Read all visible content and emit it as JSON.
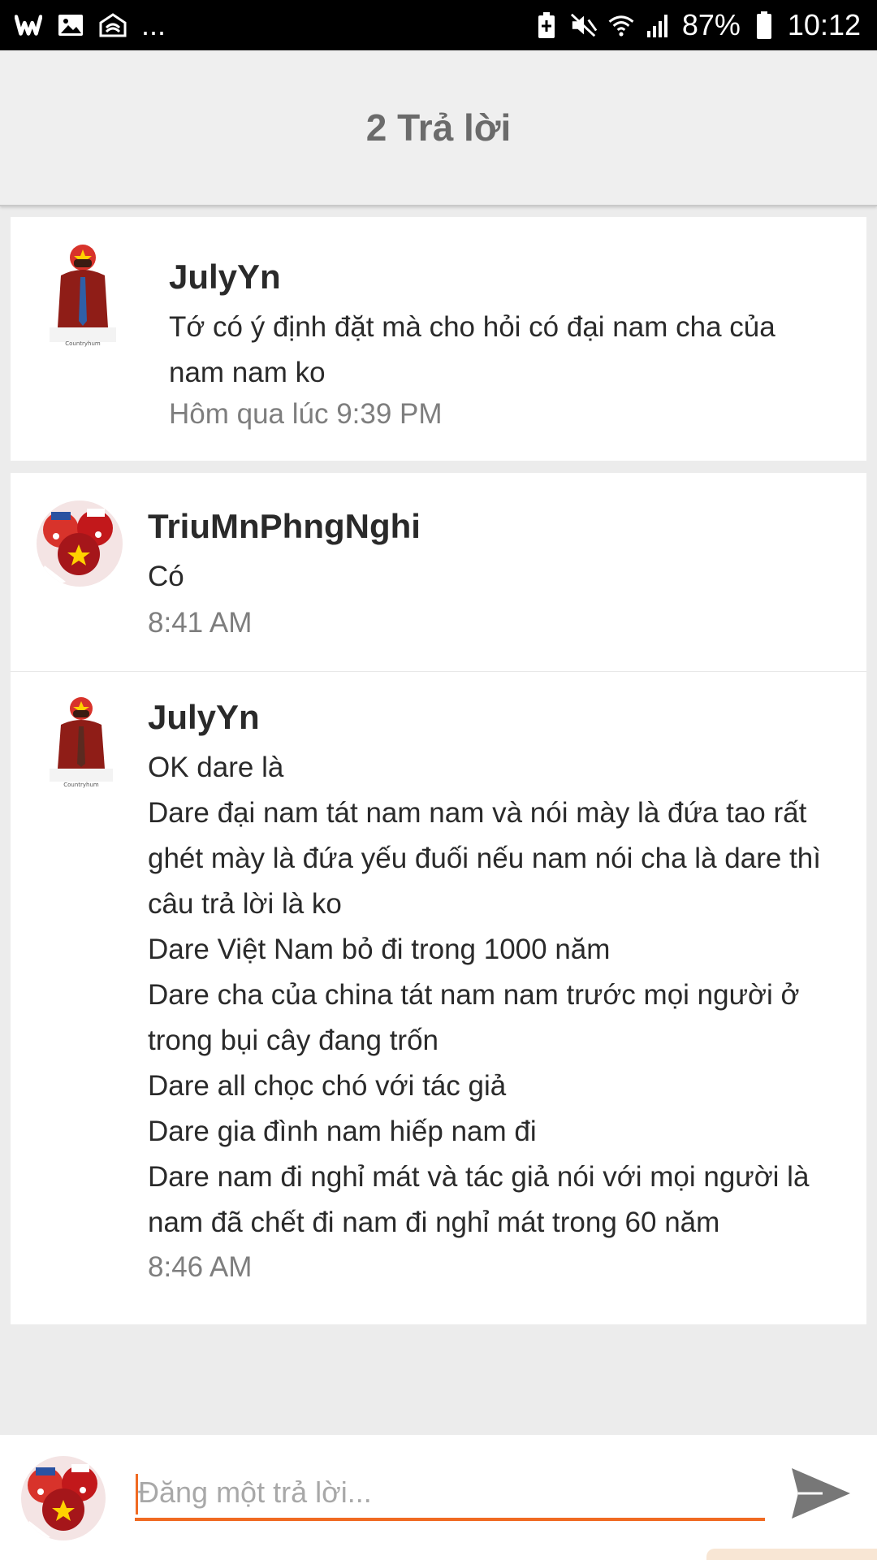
{
  "status_bar": {
    "overflow": "...",
    "battery_percent": "87%",
    "time": "10:12",
    "icons_left": [
      "wattpad-icon",
      "gallery-icon",
      "cloud-sync-icon"
    ],
    "icons_right": [
      "battery-saver-icon",
      "mute-icon",
      "wifi-icon",
      "signal-icon",
      "battery-icon"
    ]
  },
  "header": {
    "title": "2 Trả lời"
  },
  "parent_comment": {
    "username": "JulyYn",
    "lines": [
      "Tớ có ý định đặt mà cho hỏi có đại nam cha của",
      "nam nam ko"
    ],
    "time": "Hôm qua lúc 9:39 PM"
  },
  "replies": [
    {
      "username": "TriuMnPhngNghi",
      "lines": [
        "Có"
      ],
      "time": "8:41 AM"
    },
    {
      "username": "JulyYn",
      "lines": [
        "OK dare là",
        "Dare đại nam tát nam nam và nói mày là đứa tao rất",
        "ghét mày là đứa yếu đuối nếu nam nói cha là dare thì",
        "câu trả lời là ko",
        "Dare Việt Nam bỏ đi trong 1000 năm",
        "Dare cha của china tát nam nam trước mọi người ở",
        "trong bụi cây đang trốn",
        "Dare all chọc chó với tác giả",
        "Dare gia đình nam hiếp nam đi",
        "Dare nam đi nghỉ mát và tác giả nói với mọi người là",
        "nam đã chết đi nam đi nghỉ mát trong 60 năm"
      ],
      "time": "8:46 AM"
    }
  ],
  "composer": {
    "placeholder": "Đăng một trả lời...",
    "value": ""
  },
  "colors": {
    "accent": "#f06a22",
    "background": "#ececec",
    "header_bg": "#efefef",
    "card_bg": "#ffffff",
    "text_primary": "#2a2a2a",
    "text_secondary": "#7e7e7e"
  }
}
